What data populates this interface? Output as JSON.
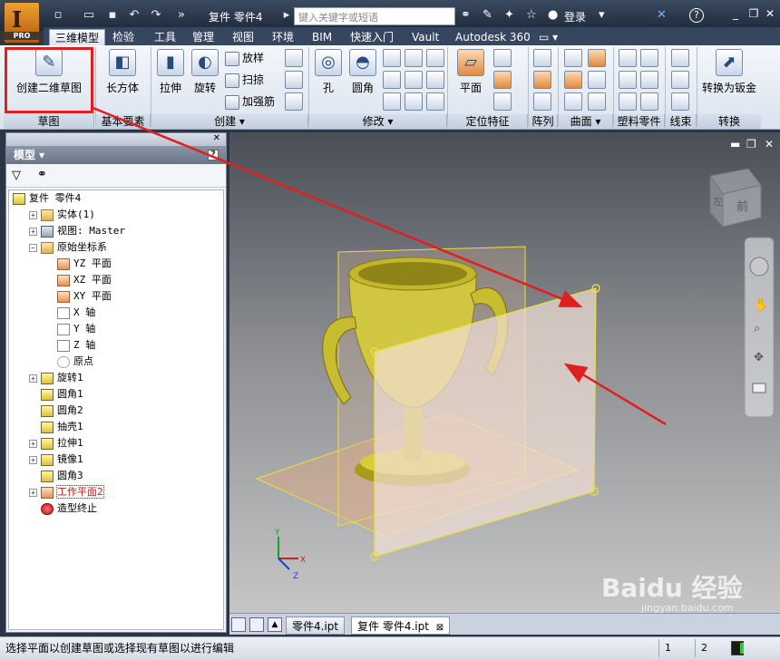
{
  "title_bar": {
    "app_logo": "I",
    "app_edition": "PRO",
    "document_title": "复件 零件4",
    "search_placeholder": "键入关键字或短语",
    "login_label": "登录",
    "help_label": "?"
  },
  "ribbon_tabs": [
    {
      "label": "三维模型",
      "active": true
    },
    {
      "label": "检验"
    },
    {
      "label": "工具"
    },
    {
      "label": "管理"
    },
    {
      "label": "视图"
    },
    {
      "label": "环境"
    },
    {
      "label": "BIM"
    },
    {
      "label": "快速入门"
    },
    {
      "label": "Vault"
    },
    {
      "label": "Autodesk 360"
    }
  ],
  "ribbon": {
    "create_sketch": "创建二维草图",
    "box": "长方体",
    "extrude": "拉伸",
    "revolve": "旋转",
    "loft": "放样",
    "sweep": "扫掠",
    "rib": "加强筋",
    "hole": "孔",
    "fillet": "圆角",
    "plane": "平面",
    "convert_sheet_metal": "转换为钣金",
    "panels": {
      "sketch": "草图",
      "primitives": "基本要素",
      "create": "创建",
      "modify": "修改",
      "work_features": "定位特征",
      "pattern": "阵列",
      "surface": "曲面",
      "plastic": "塑料零件",
      "harness": "线束",
      "convert": "转换"
    }
  },
  "browser": {
    "title": "模型 ▾",
    "tree": [
      {
        "label": "复件 零件4",
        "level": 0,
        "icon": "part",
        "expander": ""
      },
      {
        "label": "实体(1)",
        "level": 1,
        "icon": "folder",
        "expander": "+"
      },
      {
        "label": "视图: Master",
        "level": 1,
        "icon": "view",
        "expander": "+"
      },
      {
        "label": "原始坐标系",
        "level": 1,
        "icon": "folder",
        "expander": "−"
      },
      {
        "label": "YZ 平面",
        "level": 2,
        "icon": "plane",
        "expander": ""
      },
      {
        "label": "XZ 平面",
        "level": 2,
        "icon": "plane",
        "expander": ""
      },
      {
        "label": "XY 平面",
        "level": 2,
        "icon": "plane",
        "expander": ""
      },
      {
        "label": "X 轴",
        "level": 2,
        "icon": "axis",
        "expander": ""
      },
      {
        "label": "Y 轴",
        "level": 2,
        "icon": "axis",
        "expander": ""
      },
      {
        "label": "Z 轴",
        "level": 2,
        "icon": "axis",
        "expander": ""
      },
      {
        "label": "原点",
        "level": 2,
        "icon": "point",
        "expander": ""
      },
      {
        "label": "旋转1",
        "level": 1,
        "icon": "feature",
        "expander": "+"
      },
      {
        "label": "圆角1",
        "level": 1,
        "icon": "feature",
        "expander": ""
      },
      {
        "label": "圆角2",
        "level": 1,
        "icon": "feature",
        "expander": ""
      },
      {
        "label": "抽壳1",
        "level": 1,
        "icon": "feature",
        "expander": ""
      },
      {
        "label": "拉伸1",
        "level": 1,
        "icon": "feature",
        "expander": "+"
      },
      {
        "label": "镜像1",
        "level": 1,
        "icon": "feature",
        "expander": "+"
      },
      {
        "label": "圆角3",
        "level": 1,
        "icon": "feature",
        "expander": ""
      },
      {
        "label": "工作平面2",
        "level": 1,
        "icon": "plane",
        "expander": "+",
        "selected": true
      },
      {
        "label": "造型终止",
        "level": 1,
        "icon": "stop",
        "expander": ""
      }
    ]
  },
  "viewcube": {
    "left": "左",
    "front": "前"
  },
  "axes": {
    "x": "X",
    "y": "Y",
    "z": "Z"
  },
  "doc_tabs": [
    {
      "label": "零件4.ipt"
    },
    {
      "label": "复件 零件4.ipt",
      "active": true,
      "close": "⊠"
    }
  ],
  "status_bar": {
    "message": "选择平面以创建草图或选择现有草图以进行编辑",
    "count1": "1",
    "count2": "2"
  },
  "watermark": {
    "brand": "Baidu 经验",
    "url": "jingyan.baidu.com"
  },
  "colors": {
    "highlight": "#e02020",
    "arrow": "#e02020",
    "trophy": "#d7cc3a",
    "plane_fill": "#f2dfd5",
    "plane_edge": "#e8e040"
  }
}
